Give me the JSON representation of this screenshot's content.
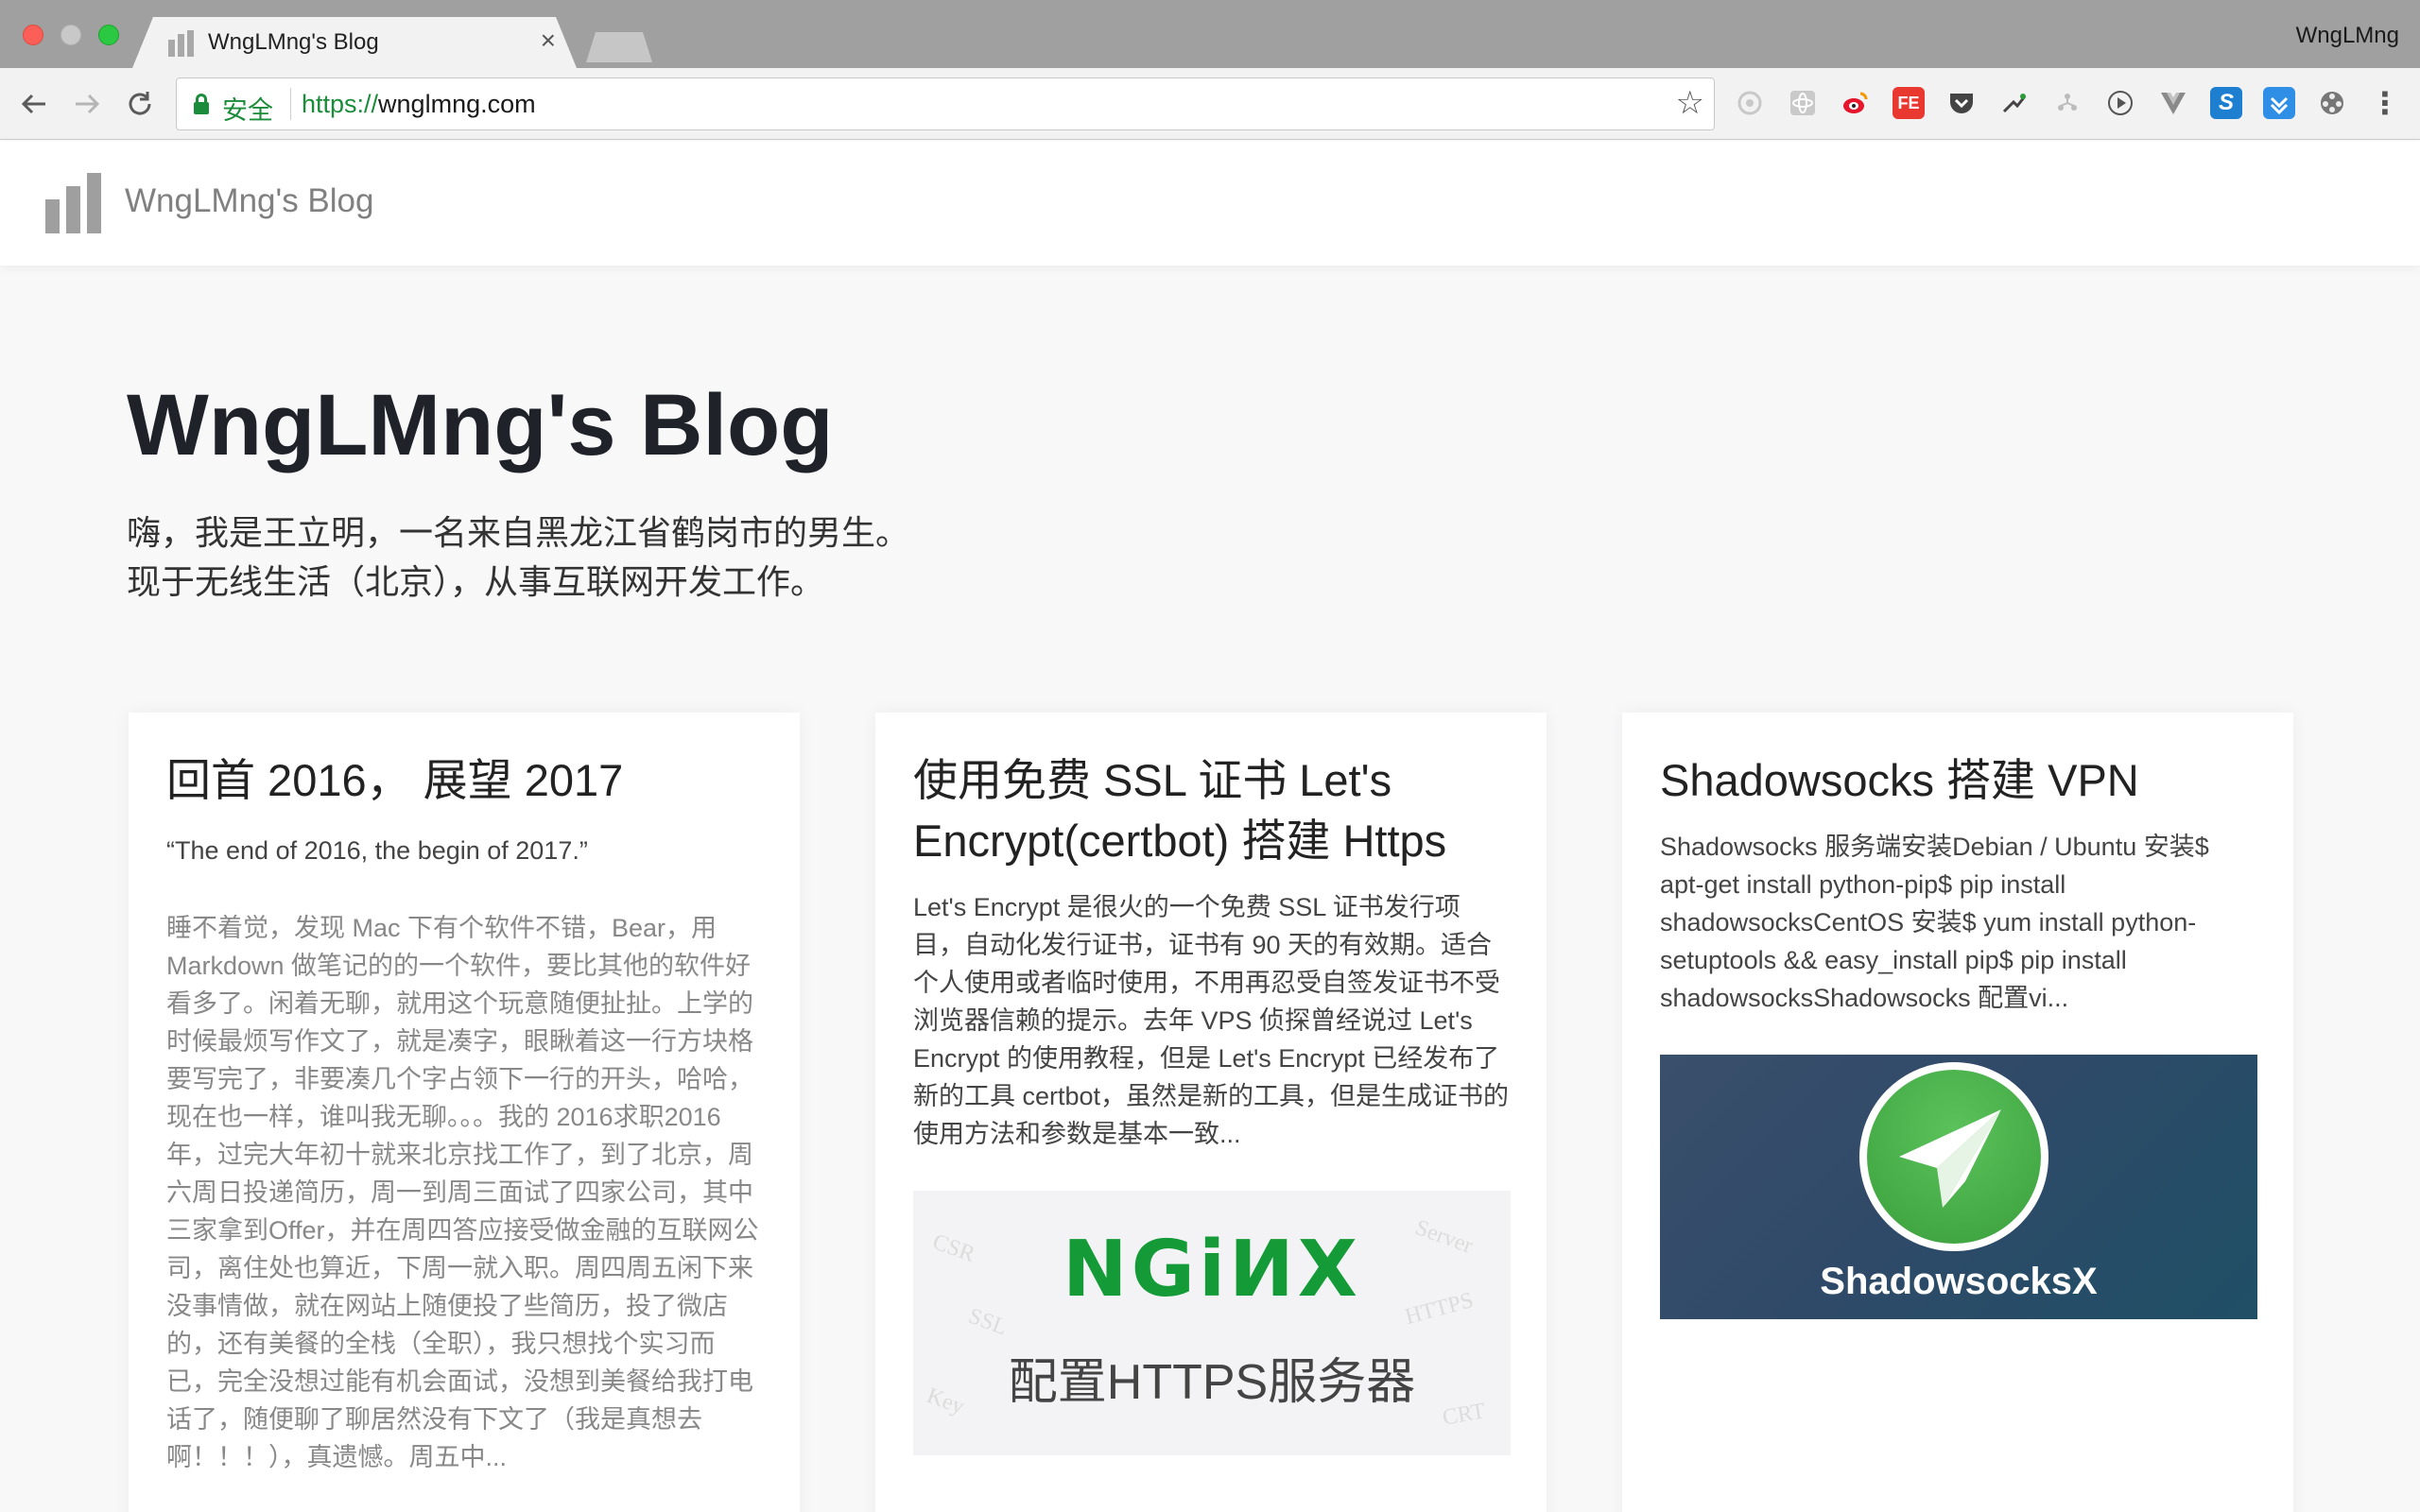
{
  "browser": {
    "tab_title": "WngLMng's Blog",
    "tab_close": "×",
    "profile_name": "WngLMng",
    "secure_label": "安全",
    "url_scheme": "https://",
    "url_host": "wnglmng.com"
  },
  "icons": {
    "back": "back-arrow-icon",
    "forward": "forward-arrow-icon",
    "reload": "reload-icon",
    "bookmark": "star-icon",
    "menu": "menu-dots-icon"
  },
  "extensions": [
    {
      "name": "vimium-extension-icon"
    },
    {
      "name": "react-devtools-extension-icon"
    },
    {
      "name": "weibo-extension-icon"
    },
    {
      "name": "fe-helper-extension-icon",
      "label": "FE"
    },
    {
      "name": "pocket-extension-icon"
    },
    {
      "name": "proxy-switch-extension-icon"
    },
    {
      "name": "tree-extension-icon"
    },
    {
      "name": "play-extension-icon"
    },
    {
      "name": "vue-devtools-extension-icon"
    },
    {
      "name": "sogou-extension-icon",
      "label": "S"
    },
    {
      "name": "download-extension-icon"
    },
    {
      "name": "film-extension-icon"
    }
  ],
  "site": {
    "name": "WngLMng's Blog"
  },
  "hero": {
    "title": "WngLMng's Blog",
    "line1": "嗨，我是王立明，一名来自黑龙江省鹤岗市的男生。",
    "line2": "现于无线生活（北京），从事互联网开发工作。"
  },
  "posts": [
    {
      "title": "回首 2016， 展望 2017",
      "subtitle": "“The end of 2016, the begin of 2017.”",
      "excerpt": "睡不着觉，发现 Mac 下有个软件不错，Bear，用 Markdown 做笔记的的一个软件，要比其他的软件好看多了。闲着无聊，就用这个玩意随便扯扯。上学的时候最烦写作文了，就是凑字，眼瞅着这一行方块格要写完了，非要凑几个字占领下一行的开头，哈哈，现在也一样，谁叫我无聊。。。我的 2016求职2016 年，过完大年初十就来北京找工作了，到了北京，周六周日投递简历，周一到周三面试了四家公司，其中三家拿到Offer，并在周四答应接受做金融的互联网公司，离住处也算近，下周一就入职。周四周五闲下来没事情做，就在网站上随便投了些简历，投了微店的，还有美餐的全栈（全职），我只想找个实习而已，完全没想过能有机会面试，没想到美餐给我打电话了，随便聊了聊居然没有下文了（我是真想去啊！！！），真遗憾。周五中..."
    },
    {
      "title": "使用免费 SSL 证书 Let's Encrypt(certbot) 搭建 Https",
      "excerpt": "Let's Encrypt 是很火的一个免费 SSL 证书发行项目，自动化发行证书，证书有 90 天的有效期。适合个人使用或者临时使用，不用再忍受自签发证书不受浏览器信赖的提示。去年 VPS 侦探曾经说过 Let's Encrypt 的使用教程，但是 Let's Encrypt 已经发布了新的工具 certbot，虽然是新的工具，但是生成证书的使用方法和参数是基本一致...",
      "image": {
        "logo": "NGiИX",
        "caption": "配置HTTPS服务器",
        "watermarks": [
          "CSR",
          "SSL",
          "Key",
          "Server",
          "HTTPS",
          "CRT"
        ]
      }
    },
    {
      "title": "Shadowsocks 搭建 VPN",
      "excerpt": "Shadowsocks 服务端安装Debian / Ubuntu 安装$ apt-get install python-pip$ pip install shadowsocksCentOS 安装$ yum install python-setuptools && easy_install pip$ pip install shadowsocksShadowsocks 配置vi...",
      "image": {
        "caption": "ShadowsocksX"
      }
    }
  ]
}
